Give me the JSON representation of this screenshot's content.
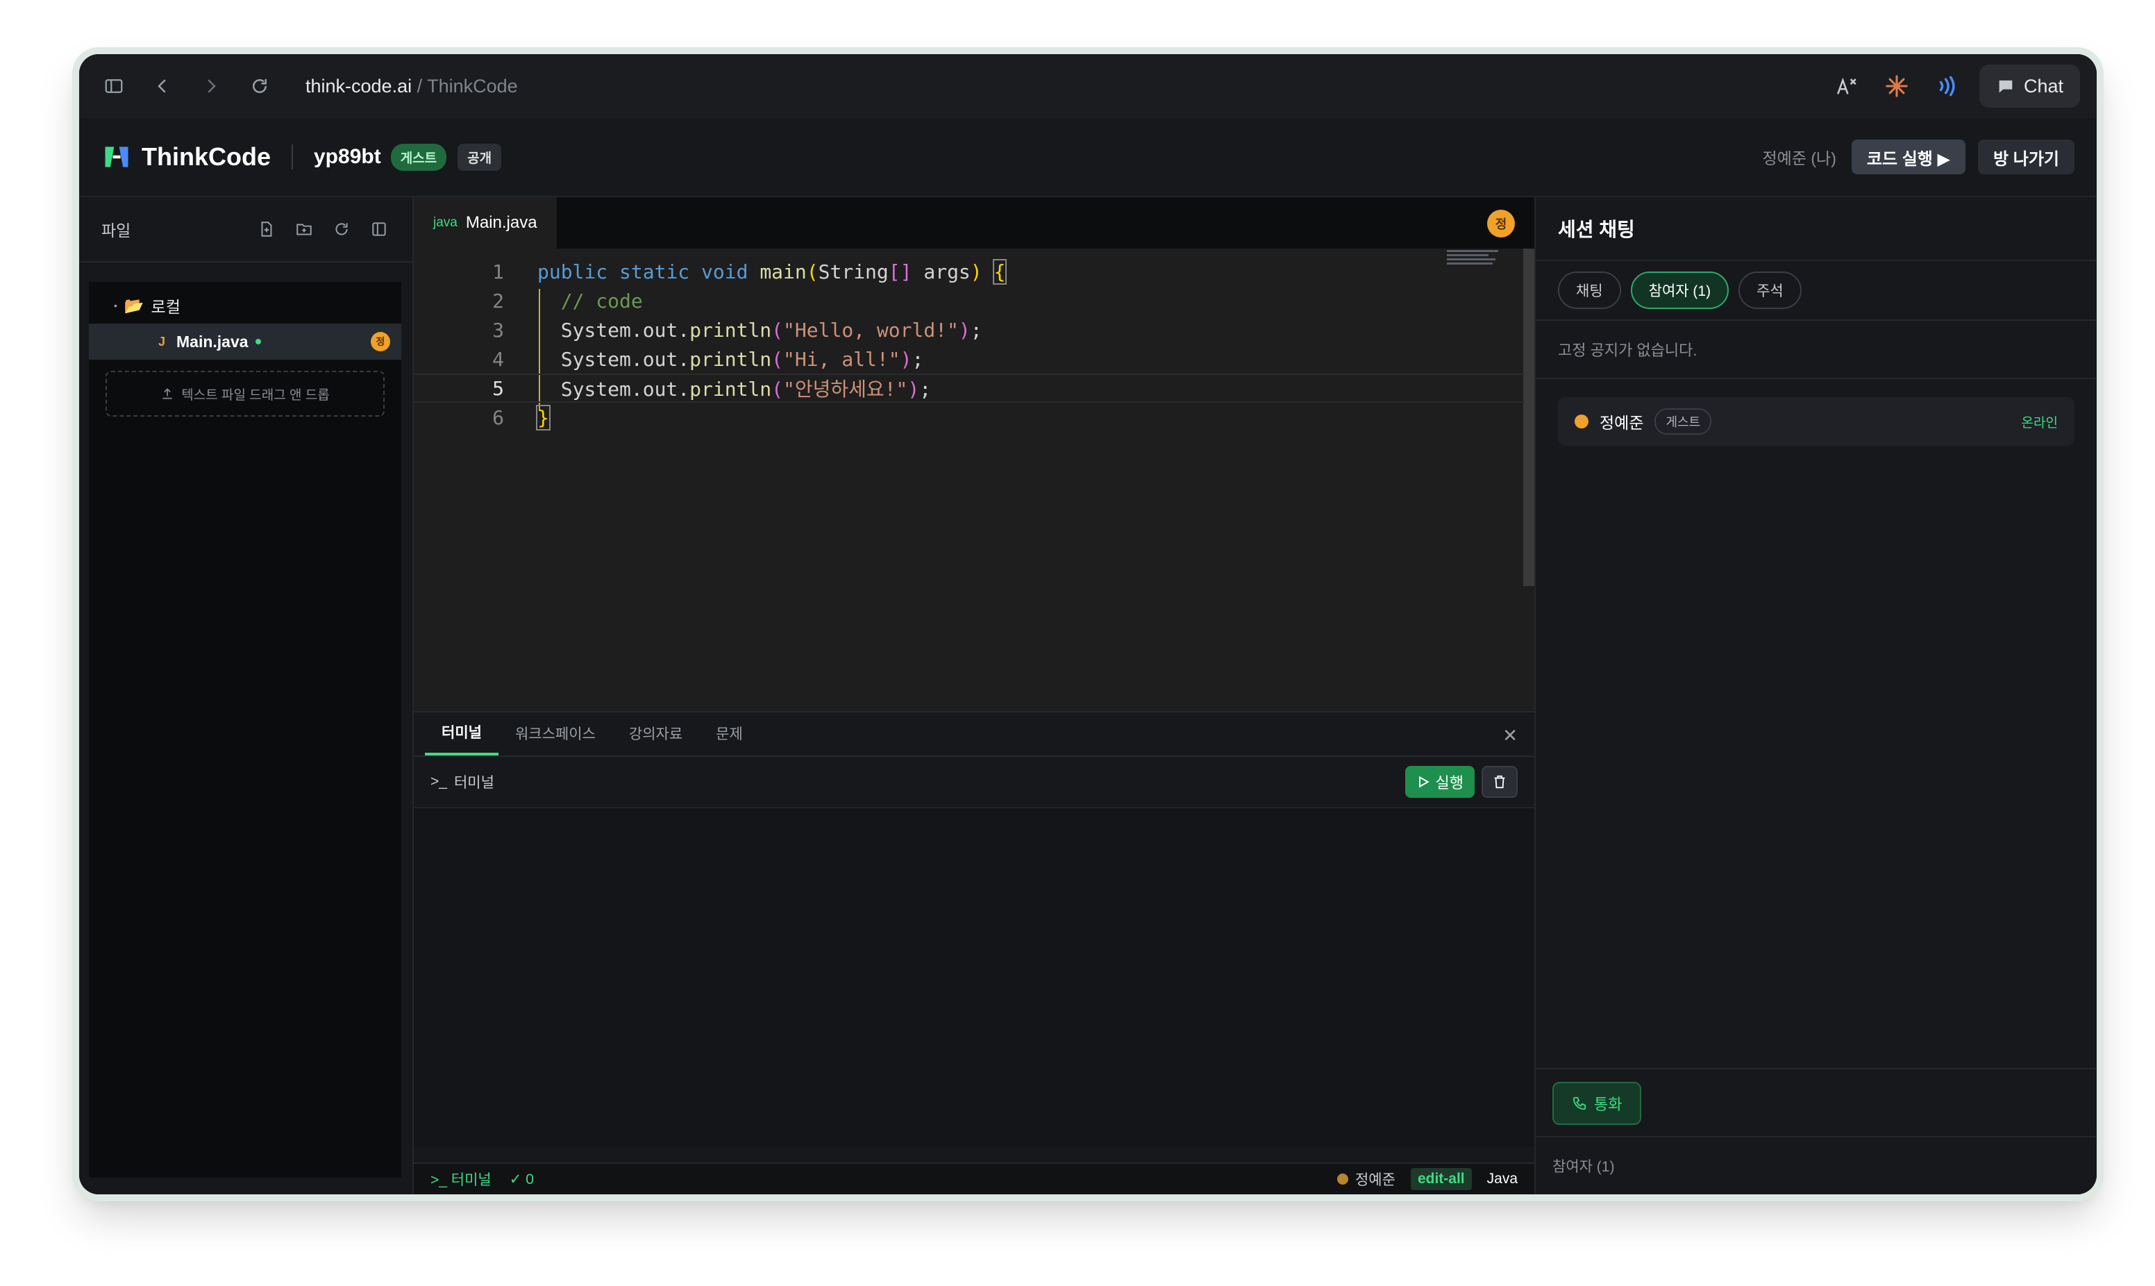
{
  "browser": {
    "url_host": "think-code.ai",
    "url_sep": " / ",
    "url_page": "ThinkCode",
    "chat_label": "Chat"
  },
  "header": {
    "app_name": "ThinkCode",
    "room_id": "yp89bt",
    "guest_badge": "게스트",
    "public_badge": "공개",
    "me_label": "정예준 (나)",
    "run_code_label": "코드 실행 ▶",
    "leave_label": "방 나가기"
  },
  "sidebar": {
    "title": "파일",
    "folder_name": "로컬",
    "file_type": "J",
    "file_name": "Main.java",
    "file_avatar": "정",
    "dropzone_label": "텍스트 파일 드래그 앤 드롭"
  },
  "editor": {
    "tab_lang": "java",
    "tab_name": "Main.java",
    "avatar": "정",
    "line_numbers": [
      "1",
      "2",
      "3",
      "4",
      "5",
      "6"
    ],
    "active_line": 5
  },
  "panel": {
    "tabs": [
      "터미널",
      "워크스페이스",
      "강의자료",
      "문제"
    ],
    "active_tab": "터미널",
    "terminal_label": "터미널",
    "run_label": "실행"
  },
  "status": {
    "terminal_label": "터미널",
    "check_count": "0",
    "user": "정예준",
    "permission": "edit-all",
    "language": "Java"
  },
  "right_panel": {
    "title": "세션 채팅",
    "tabs": [
      "채팅",
      "참여자 (1)",
      "주석"
    ],
    "active_tab": "참여자 (1)",
    "notice": "고정 공지가 없습니다.",
    "participant": {
      "name": "정예준",
      "tag": "게스트",
      "status": "온라인"
    },
    "call_label": "통화",
    "participant_count": "참여자 (1)"
  },
  "colors": {
    "accent_green": "#3ddc84",
    "avatar_orange": "#f0a12a",
    "background": "#0f1012"
  }
}
